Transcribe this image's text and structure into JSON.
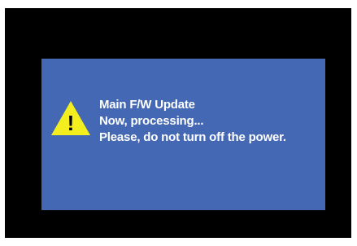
{
  "colors": {
    "outer_background": "#000000",
    "dialog_background": "#4468b3",
    "text": "#ffffff",
    "warning_fill": "#f5ee1f",
    "warning_mark": "#000000"
  },
  "dialog": {
    "icon": "warning-triangle-icon",
    "icon_glyph": "!",
    "title": "Main F/W Update",
    "status": "Now, processing...",
    "instruction": "Please, do not turn off the power."
  }
}
